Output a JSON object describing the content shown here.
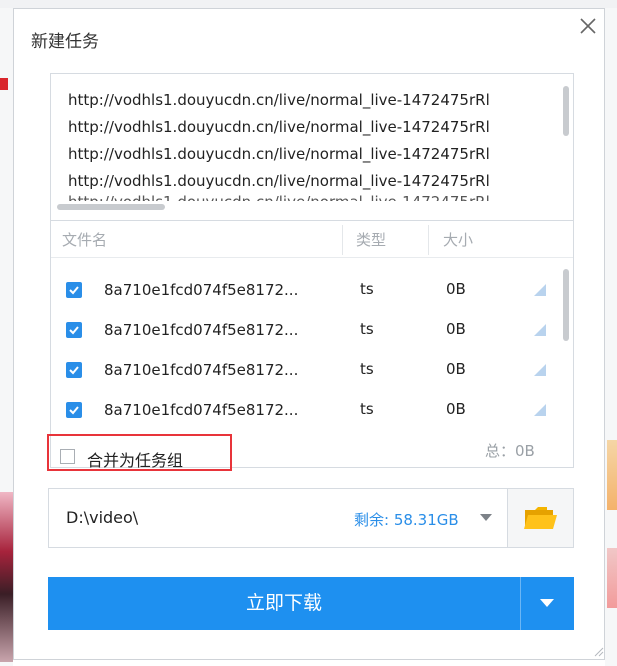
{
  "dialog": {
    "title": "新建任务",
    "close_icon": "close-icon"
  },
  "urls": [
    "http://vodhls1.douyucdn.cn/live/normal_live-1472475rRl",
    "http://vodhls1.douyucdn.cn/live/normal_live-1472475rRl",
    "http://vodhls1.douyucdn.cn/live/normal_live-1472475rRl",
    "http://vodhls1.douyucdn.cn/live/normal_live-1472475rRl"
  ],
  "file_list": {
    "headers": {
      "name": "文件名",
      "type": "类型",
      "size": "大小"
    },
    "rows": [
      {
        "checked": true,
        "name": "8a710e1fcd074f5e8172...",
        "type": "ts",
        "size": "0B"
      },
      {
        "checked": true,
        "name": "8a710e1fcd074f5e8172...",
        "type": "ts",
        "size": "0B"
      },
      {
        "checked": true,
        "name": "8a710e1fcd074f5e8172...",
        "type": "ts",
        "size": "0B"
      },
      {
        "checked": true,
        "name": "8a710e1fcd074f5e8172...",
        "type": "ts",
        "size": "0B"
      }
    ],
    "merge_label": "合并为任务组",
    "merge_checked": false,
    "total": "总：0B"
  },
  "save": {
    "path": "D:\\video\\",
    "free_space": "剩余: 58.31GB",
    "folder_icon": "folder-icon"
  },
  "download": {
    "button_label": "立即下载",
    "more_icon": "caret-down-icon"
  },
  "colors": {
    "accent": "#1e90f0",
    "highlight": "#e8343a",
    "folder": "#f4b400"
  }
}
